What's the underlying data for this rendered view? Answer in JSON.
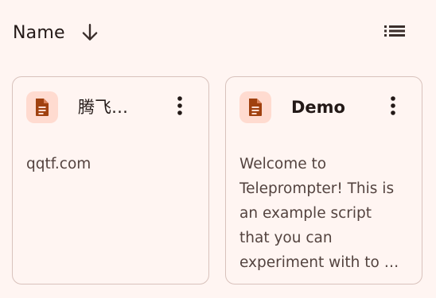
{
  "toolbar": {
    "sort_label": "Name",
    "sort_icon": "arrow-down-icon",
    "view_icon": "list-view-icon"
  },
  "cards": [
    {
      "icon": "document-icon",
      "title": "腾飞…",
      "menu_icon": "more-vert-icon",
      "preview_lines": [
        "qqtf.com"
      ]
    },
    {
      "icon": "document-icon",
      "title": "Demo",
      "menu_icon": "more-vert-icon",
      "preview_lines": [
        "Welcome to",
        "Teleprompter! This is",
        "an example script",
        "that you can",
        "experiment with to …"
      ]
    }
  ],
  "colors": {
    "background": "#FFF5F2",
    "icon_container": "#FFDBD0",
    "icon_fill": "#A0410F",
    "card_border": "#D8C2BC",
    "text_primary": "#231917",
    "text_secondary": "#53433F"
  }
}
